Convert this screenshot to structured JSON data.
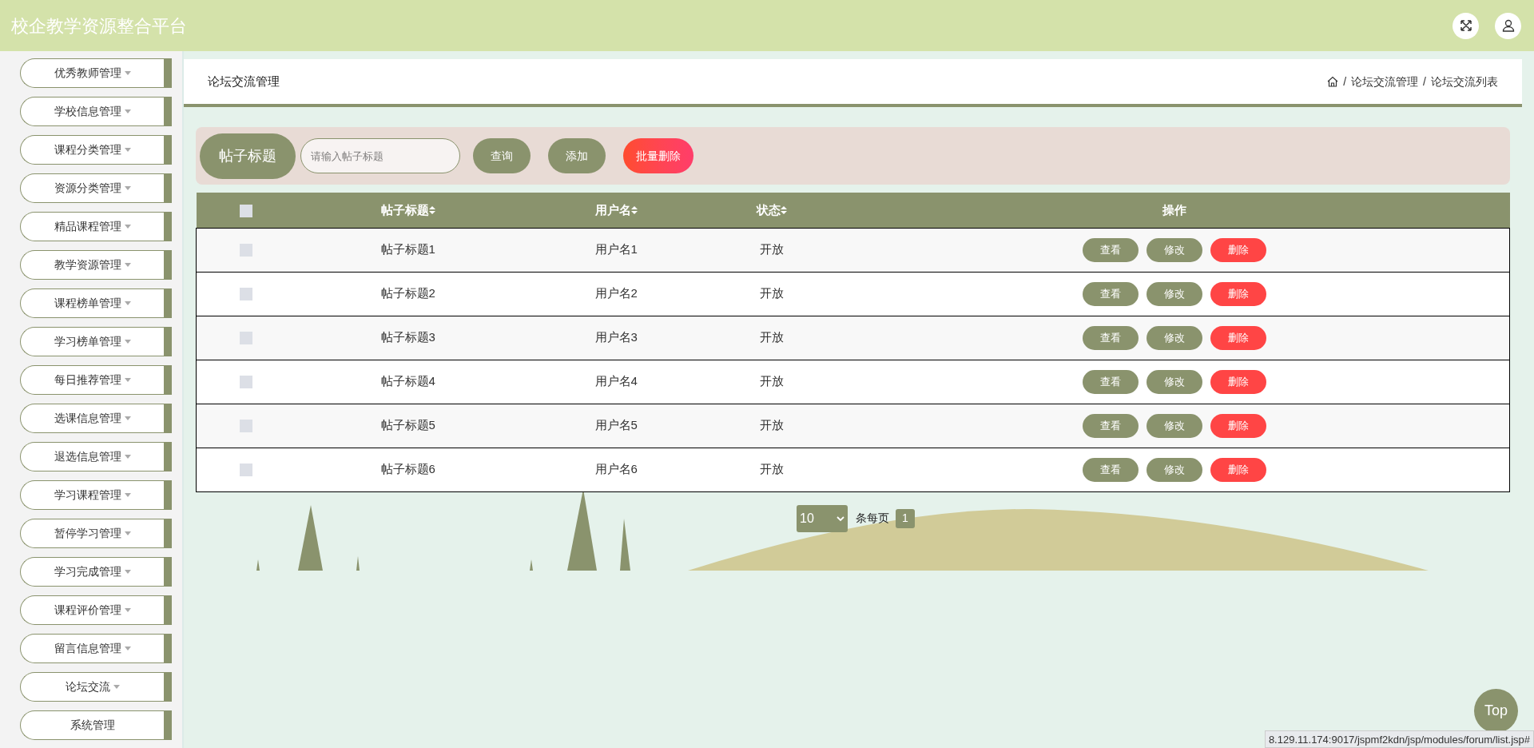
{
  "header": {
    "title": "校企教学资源整合平台"
  },
  "sidebar": {
    "items": [
      {
        "label": "优秀教师管理",
        "has_caret": true
      },
      {
        "label": "学校信息管理",
        "has_caret": true
      },
      {
        "label": "课程分类管理",
        "has_caret": true
      },
      {
        "label": "资源分类管理",
        "has_caret": true
      },
      {
        "label": "精品课程管理",
        "has_caret": true
      },
      {
        "label": "教学资源管理",
        "has_caret": true
      },
      {
        "label": "课程榜单管理",
        "has_caret": true
      },
      {
        "label": "学习榜单管理",
        "has_caret": true
      },
      {
        "label": "每日推荐管理",
        "has_caret": true
      },
      {
        "label": "选课信息管理",
        "has_caret": true
      },
      {
        "label": "退选信息管理",
        "has_caret": true
      },
      {
        "label": "学习课程管理",
        "has_caret": true
      },
      {
        "label": "暂停学习管理",
        "has_caret": true
      },
      {
        "label": "学习完成管理",
        "has_caret": true
      },
      {
        "label": "课程评价管理",
        "has_caret": true
      },
      {
        "label": "留言信息管理",
        "has_caret": true
      },
      {
        "label": "论坛交流",
        "has_caret": true
      },
      {
        "label": "系统管理",
        "has_caret": false
      }
    ]
  },
  "page_header": {
    "title": "论坛交流管理",
    "breadcrumb": [
      {
        "separator": "/",
        "label": "论坛交流管理"
      },
      {
        "separator": "/",
        "label": "论坛交流列表"
      }
    ]
  },
  "search": {
    "label": "帖子标题",
    "placeholder": "请输入帖子标题",
    "buttons": [
      {
        "label": "查询",
        "kind": "primary"
      },
      {
        "label": "添加",
        "kind": "primary"
      },
      {
        "label": "批量删除",
        "kind": "danger"
      }
    ]
  },
  "table": {
    "all_selected": false,
    "columns": [
      {
        "label": "帖子标题",
        "sortable": true
      },
      {
        "label": "用户名",
        "sortable": true
      },
      {
        "label": "状态",
        "sortable": true
      },
      {
        "label": "操作",
        "sortable": false
      }
    ],
    "rows": [
      {
        "selected": false,
        "title": "帖子标题1",
        "username": "用户名1",
        "status": "开放",
        "actions": [
          {
            "label": "查看",
            "kind": "primary"
          },
          {
            "label": "修改",
            "kind": "primary"
          },
          {
            "label": "删除",
            "kind": "danger"
          }
        ]
      },
      {
        "selected": false,
        "title": "帖子标题2",
        "username": "用户名2",
        "status": "开放",
        "actions": [
          {
            "label": "查看",
            "kind": "primary"
          },
          {
            "label": "修改",
            "kind": "primary"
          },
          {
            "label": "删除",
            "kind": "danger"
          }
        ]
      },
      {
        "selected": false,
        "title": "帖子标题3",
        "username": "用户名3",
        "status": "开放",
        "actions": [
          {
            "label": "查看",
            "kind": "primary"
          },
          {
            "label": "修改",
            "kind": "primary"
          },
          {
            "label": "删除",
            "kind": "danger"
          }
        ]
      },
      {
        "selected": false,
        "title": "帖子标题4",
        "username": "用户名4",
        "status": "开放",
        "actions": [
          {
            "label": "查看",
            "kind": "primary"
          },
          {
            "label": "修改",
            "kind": "primary"
          },
          {
            "label": "删除",
            "kind": "danger"
          }
        ]
      },
      {
        "selected": false,
        "title": "帖子标题5",
        "username": "用户名5",
        "status": "开放",
        "actions": [
          {
            "label": "查看",
            "kind": "primary"
          },
          {
            "label": "修改",
            "kind": "primary"
          },
          {
            "label": "删除",
            "kind": "danger"
          }
        ]
      },
      {
        "selected": false,
        "title": "帖子标题6",
        "username": "用户名6",
        "status": "开放",
        "actions": [
          {
            "label": "查看",
            "kind": "primary"
          },
          {
            "label": "修改",
            "kind": "primary"
          },
          {
            "label": "删除",
            "kind": "danger"
          }
        ]
      }
    ]
  },
  "pagination": {
    "page_size": "10",
    "per_page_label": "条每页",
    "pages": [
      {
        "label": "1",
        "selected": true
      }
    ]
  },
  "back_to_top": "Top",
  "status_url": "8.129.11.174:9017/jspmf2kdn/jsp/modules/forum/list.jsp#"
}
